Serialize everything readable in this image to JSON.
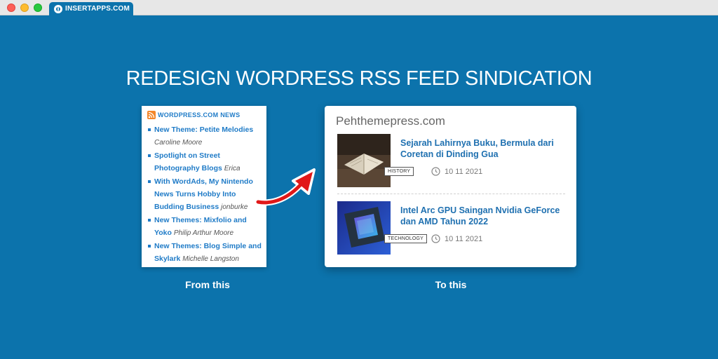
{
  "window": {
    "tab_label": "INSERTAPPS.COM",
    "tab_logo_icon": "insertapps-logo-icon"
  },
  "headline": "REDESIGN WORDRESS RSS FEED SINDICATION",
  "old_widget": {
    "title": "WORDPRESS.COM NEWS",
    "icon": "rss-icon",
    "items": [
      {
        "title": "New Theme: Petite Melodies",
        "author": "Caroline Moore"
      },
      {
        "title": "Spotlight on Street Photography Blogs",
        "author": "Erica"
      },
      {
        "title": "With WordAds, My Nintendo News Turns Hobby Into Budding Business",
        "author": "jonburke"
      },
      {
        "title": "New Themes: Mixfolio and Yoko",
        "author": "Philip Arthur Moore"
      },
      {
        "title": "New Themes: Blog Simple and Skylark",
        "author": "Michelle Langston"
      }
    ]
  },
  "new_widget": {
    "site_name": "Pehthemepress.com",
    "posts": [
      {
        "title": "Sejarah Lahirnya Buku, Bermula dari Coretan di Dinding Gua",
        "category": "HISTORY",
        "date": "10 11 2021"
      },
      {
        "title": "Intel Arc GPU Saingan Nvidia GeForce dan AMD Tahun 2022",
        "category": "TECHNOLOGY",
        "date": "10 11 2021"
      }
    ]
  },
  "captions": {
    "from": "From this",
    "to": "To this"
  },
  "colors": {
    "background": "#0c73ac",
    "link": "#1f7bc7",
    "arrow": "#e11818"
  }
}
